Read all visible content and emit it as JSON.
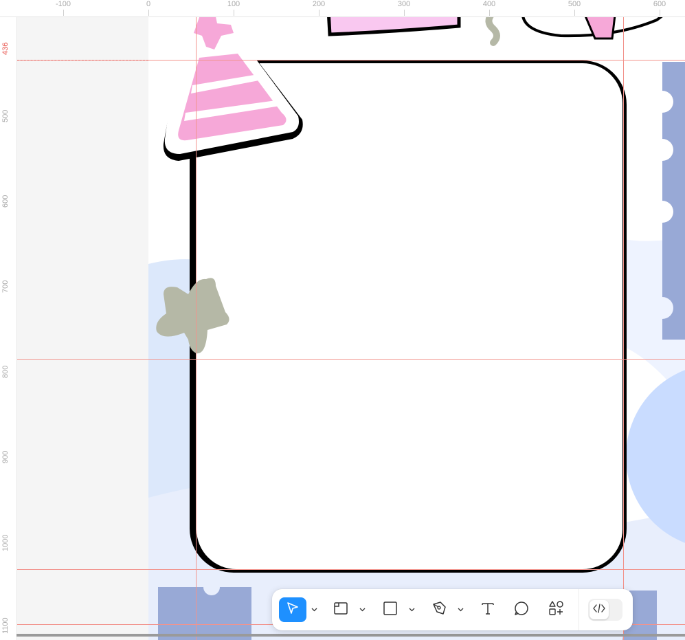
{
  "ruler": {
    "top": [
      "-100",
      "0",
      "100",
      "200",
      "300",
      "400",
      "500",
      "600"
    ],
    "left": [
      "436",
      "500",
      "600",
      "700",
      "800",
      "900",
      "1000",
      "1100"
    ],
    "highlight": "436"
  },
  "colors": {
    "accent": "#1e90ff",
    "guide": "#f2938c",
    "pink": "#f6a8d8",
    "sage": "#b5b8a6",
    "periwinkle": "#98a9d6",
    "light_blue": "#c9dcff"
  },
  "toolbar": {
    "tools": [
      {
        "name": "move-tool",
        "icon": "cursor-arrow-icon",
        "active": true
      },
      {
        "name": "frame-tool",
        "icon": "frame-icon",
        "active": false
      },
      {
        "name": "rectangle-tool",
        "icon": "rectangle-icon",
        "active": false
      },
      {
        "name": "pen-tool",
        "icon": "pen-icon",
        "active": false
      },
      {
        "name": "text-tool",
        "icon": "text-icon",
        "active": false
      },
      {
        "name": "comment-tool",
        "icon": "comment-bubble-icon",
        "active": false
      },
      {
        "name": "actions-tool",
        "icon": "shapes-plus-icon",
        "active": false
      }
    ],
    "dev_mode": {
      "icon": "code-icon",
      "enabled": false
    }
  }
}
